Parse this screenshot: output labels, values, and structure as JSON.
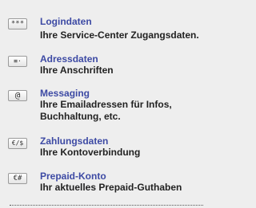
{
  "menu": {
    "items": [
      {
        "icon_text": "***",
        "icon_name": "password-icon",
        "title": "Logindaten",
        "description": "Ihre Service-Center Zugangsdaten."
      },
      {
        "icon_text": "≡·",
        "icon_name": "address-card-icon",
        "title": "Adressdaten",
        "description": "Ihre Anschriften"
      },
      {
        "icon_text": "@",
        "icon_name": "at-sign-icon",
        "title": "Messaging",
        "description": "Ihre Emailadressen für Infos, Buchhaltung, etc."
      },
      {
        "icon_text": "€/$",
        "icon_name": "currency-icon",
        "title": "Zahlungsdaten",
        "description": "Ihre Kontoverbindung"
      },
      {
        "icon_text": "€#",
        "icon_name": "prepaid-icon",
        "title": "Prepaid-Konto",
        "description": "Ihr aktuelles Prepaid-Guthaben"
      }
    ]
  }
}
